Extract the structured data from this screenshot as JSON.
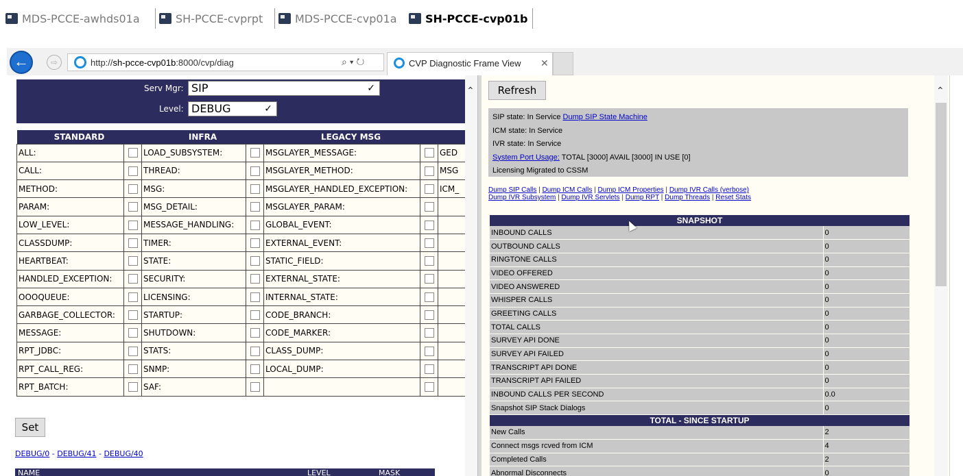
{
  "rdp_tabs": [
    {
      "label": "MDS-PCCE-awhds01a",
      "active": false
    },
    {
      "label": "SH-PCCE-cvprpt",
      "active": false
    },
    {
      "label": "MDS-PCCE-cvp01a",
      "active": false
    },
    {
      "label": "SH-PCCE-cvp01b",
      "active": true
    }
  ],
  "browser": {
    "url_prefix": "http://",
    "url_host": "sh-pcce-cvp01b",
    "url_rest": ":8000/cvp/diag",
    "addr_controls": "⌕ ▾ ↻",
    "tab_title": "CVP Diagnostic Frame View",
    "tab_close": "✕"
  },
  "left": {
    "servmgr_label": "Serv Mgr:",
    "servmgr_value": "SIP",
    "level_label": "Level:",
    "level_value": "DEBUG",
    "col_headers": [
      "STANDARD",
      "INFRA",
      "LEGACY MSG"
    ],
    "rows": [
      [
        "ALL:",
        "LOAD_SUBSYSTEM:",
        "MSGLAYER_MESSAGE:",
        "GED"
      ],
      [
        "CALL:",
        "THREAD:",
        "MSGLAYER_METHOD:",
        "MSG"
      ],
      [
        "METHOD:",
        "MSG:",
        "MSGLAYER_HANDLED_EXCEPTION:",
        "ICM_"
      ],
      [
        "PARAM:",
        "MSG_DETAIL:",
        "MSGLAYER_PARAM:",
        ""
      ],
      [
        "LOW_LEVEL:",
        "MESSAGE_HANDLING:",
        "GLOBAL_EVENT:",
        ""
      ],
      [
        "CLASSDUMP:",
        "TIMER:",
        "EXTERNAL_EVENT:",
        ""
      ],
      [
        "HEARTBEAT:",
        "STATE:",
        "STATIC_FIELD:",
        ""
      ],
      [
        "HANDLED_EXCEPTION:",
        "SECURITY:",
        "EXTERNAL_STATE:",
        ""
      ],
      [
        "OOOQUEUE:",
        "LICENSING:",
        "INTERNAL_STATE:",
        ""
      ],
      [
        "GARBAGE_COLLECTOR:",
        "STARTUP:",
        "CODE_BRANCH:",
        ""
      ],
      [
        "MESSAGE:",
        "SHUTDOWN:",
        "CODE_MARKER:",
        ""
      ],
      [
        "RPT_JDBC:",
        "STATS:",
        "CLASS_DUMP:",
        ""
      ],
      [
        "RPT_CALL_REG:",
        "SNMP:",
        "LOCAL_DUMP:",
        ""
      ],
      [
        "RPT_BATCH:",
        "SAF:",
        "",
        ""
      ]
    ],
    "set_label": "Set",
    "debug_links": [
      "DEBUG/0",
      "DEBUG/41",
      "DEBUG/40"
    ],
    "name_header": [
      "NAME",
      "LEVEL",
      "MASK"
    ]
  },
  "right": {
    "refresh_label": "Refresh",
    "sip_state": "SIP state: In Service",
    "dump_sip_sm": "Dump SIP State Machine",
    "icm_state": "ICM state: In Service",
    "ivr_state": "IVR state: In Service",
    "port_usage_label": "System Port Usage:",
    "port_usage_value": "TOTAL [3000] AVAIL [3000] IN USE [0]",
    "licensing": "Licensing Migrated to CSSM",
    "dump_links_1": [
      "Dump SIP Calls",
      "Dump ICM Calls",
      "Dump ICM Properties",
      "Dump IVR Calls (verbose)"
    ],
    "dump_links_2": [
      "Dump IVR Subsystem",
      "Dump IVR Servlets",
      "Dump RPT",
      "Dump Threads",
      "Reset Stats"
    ],
    "snapshot_header": "SNAPSHOT",
    "snapshot": [
      [
        "INBOUND CALLS",
        "0"
      ],
      [
        "OUTBOUND CALLS",
        "0"
      ],
      [
        "RINGTONE CALLS",
        "0"
      ],
      [
        "VIDEO OFFERED",
        "0"
      ],
      [
        "VIDEO ANSWERED",
        "0"
      ],
      [
        "WHISPER CALLS",
        "0"
      ],
      [
        "GREETING CALLS",
        "0"
      ],
      [
        "TOTAL CALLS",
        "0"
      ],
      [
        "SURVEY API DONE",
        "0"
      ],
      [
        "SURVEY API FAILED",
        "0"
      ],
      [
        "TRANSCRIPT API DONE",
        "0"
      ],
      [
        "TRANSCRIPT API FAILED",
        "0"
      ],
      [
        "INBOUND CALLS PER SECOND",
        "0.0"
      ],
      [
        "Snapshot SIP Stack Dialogs",
        "0"
      ]
    ],
    "total_header": "TOTAL - SINCE STARTUP",
    "total": [
      [
        "New Calls",
        "2"
      ],
      [
        "Connect msgs rcved from ICM",
        "4"
      ],
      [
        "Completed Calls",
        "2"
      ],
      [
        "Abnormal Disconnects",
        "0"
      ]
    ]
  },
  "colors": {
    "header_navy": "#2c2c5e",
    "panel_bg": "#fffdf4",
    "stat_cell": "#c8c8c8",
    "link": "#0000cc"
  }
}
